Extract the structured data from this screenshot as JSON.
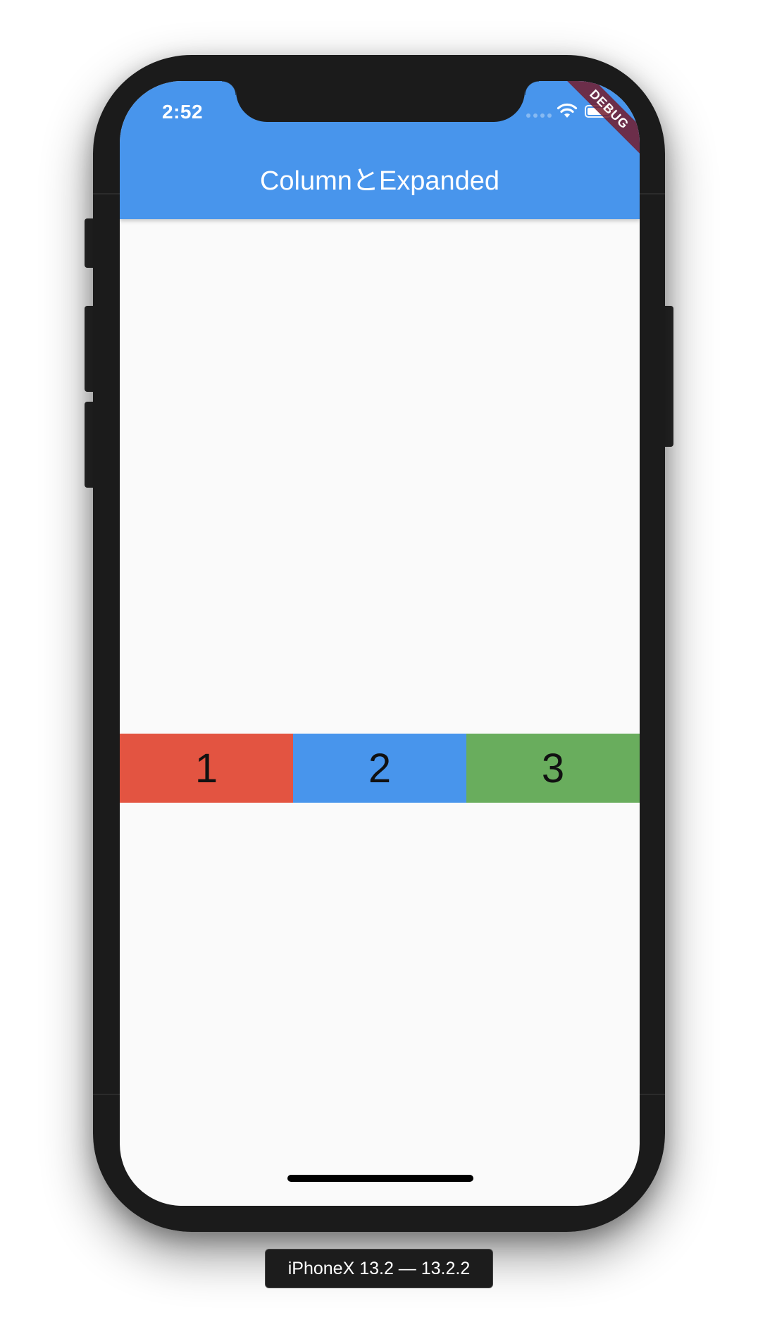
{
  "status_bar": {
    "time": "2:52"
  },
  "app": {
    "title": "ColumnとExpanded",
    "debug_banner": "DEBUG",
    "colors": {
      "appbar": "#4895ec",
      "background": "#fafafa"
    }
  },
  "row": {
    "items": [
      {
        "label": "1",
        "color": "#e35441"
      },
      {
        "label": "2",
        "color": "#4895ec"
      },
      {
        "label": "3",
        "color": "#69ad5d"
      }
    ]
  },
  "device": {
    "label": "iPhoneX 13.2 — 13.2.2"
  }
}
